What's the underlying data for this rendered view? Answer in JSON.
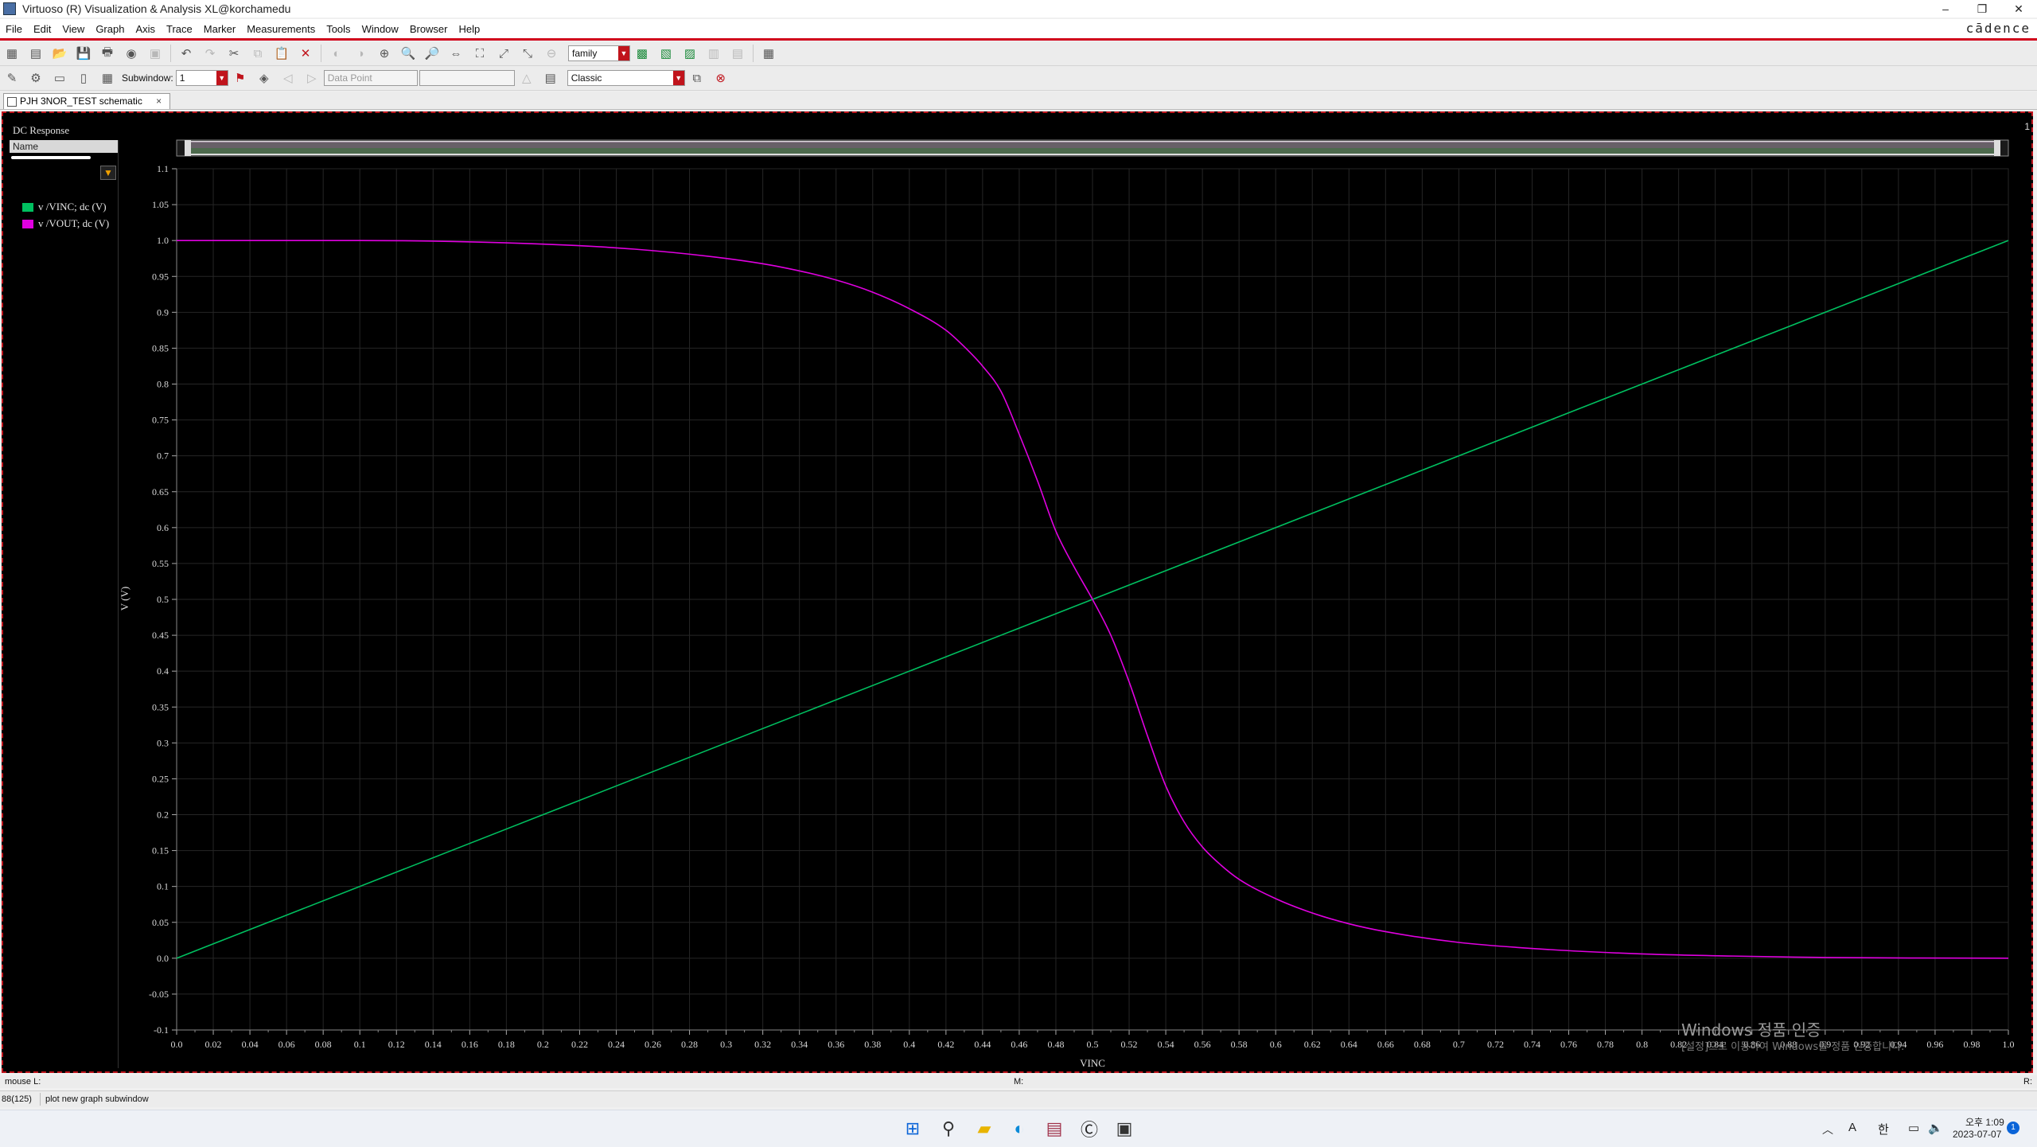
{
  "window": {
    "title": "Virtuoso (R) Visualization & Analysis XL@korchamedu",
    "controls": [
      "–",
      "❐",
      "✕"
    ]
  },
  "menu": [
    "File",
    "Edit",
    "View",
    "Graph",
    "Axis",
    "Trace",
    "Marker",
    "Measurements",
    "Tools",
    "Window",
    "Browser",
    "Help"
  ],
  "brand": "cādence",
  "toolbar": {
    "family_combo": "family",
    "subwindow_label": "Subwindow:",
    "subwindow_value": "1",
    "data_point_combo": "Data Point",
    "style_combo": "Classic"
  },
  "tab": {
    "label": "PJH 3NOR_TEST schematic",
    "close": "×"
  },
  "plot": {
    "title": "DC Response",
    "subwindow_index": "1",
    "legend_header": "Name",
    "legend": [
      {
        "label": "v /VINC; dc (V)",
        "color": "#00c060"
      },
      {
        "label": "v /VOUT; dc (V)",
        "color": "#e000e0"
      }
    ]
  },
  "chart_data": {
    "type": "line",
    "xlabel": "VINC",
    "ylabel": "V (V)",
    "xlim": [
      0.0,
      1.0
    ],
    "ylim": [
      -0.1,
      1.1
    ],
    "grid": true,
    "x_ticks": [
      "0.0",
      "0.02",
      "0.04",
      "0.06",
      "0.08",
      "0.1",
      "0.12",
      "0.14",
      "0.16",
      "0.18",
      "0.2",
      "0.22",
      "0.24",
      "0.26",
      "0.28",
      "0.3",
      "0.32",
      "0.34",
      "0.36",
      "0.38",
      "0.4",
      "0.42",
      "0.44",
      "0.46",
      "0.48",
      "0.5",
      "0.52",
      "0.54",
      "0.56",
      "0.58",
      "0.6",
      "0.62",
      "0.64",
      "0.66",
      "0.68",
      "0.7",
      "0.72",
      "0.74",
      "0.76",
      "0.78",
      "0.8",
      "0.82",
      "0.84",
      "0.86",
      "0.88",
      "0.9",
      "0.92",
      "0.94",
      "0.96",
      "0.98",
      "1.0"
    ],
    "y_ticks": [
      "1.1",
      "1.05",
      "1.0",
      "0.95",
      "0.9",
      "0.85",
      "0.8",
      "0.75",
      "0.7",
      "0.65",
      "0.6",
      "0.55",
      "0.5",
      "0.45",
      "0.4",
      "0.35",
      "0.3",
      "0.25",
      "0.2",
      "0.15",
      "0.1",
      "0.05",
      "0.0",
      "-0.05",
      "-0.1"
    ],
    "series": [
      {
        "name": "v /VINC; dc (V)",
        "color": "#00c060",
        "x": [
          0.0,
          1.0
        ],
        "y": [
          0.0,
          1.0
        ]
      },
      {
        "name": "v /VOUT; dc (V)",
        "color": "#e000e0",
        "x": [
          0.0,
          0.1,
          0.2,
          0.25,
          0.3,
          0.33,
          0.36,
          0.38,
          0.4,
          0.42,
          0.43,
          0.44,
          0.45,
          0.46,
          0.47,
          0.48,
          0.49,
          0.5,
          0.51,
          0.52,
          0.53,
          0.54,
          0.55,
          0.56,
          0.57,
          0.58,
          0.6,
          0.62,
          0.64,
          0.66,
          0.7,
          0.75,
          0.8,
          0.85,
          0.9,
          1.0
        ],
        "y": [
          1.0,
          1.0,
          0.995,
          0.988,
          0.975,
          0.963,
          0.945,
          0.928,
          0.905,
          0.875,
          0.852,
          0.825,
          0.79,
          0.73,
          0.665,
          0.595,
          0.545,
          0.5,
          0.45,
          0.385,
          0.31,
          0.24,
          0.19,
          0.155,
          0.13,
          0.11,
          0.083,
          0.063,
          0.048,
          0.037,
          0.022,
          0.012,
          0.006,
          0.003,
          0.001,
          0.0
        ]
      }
    ]
  },
  "status": {
    "mouse": "mouse L:",
    "middle": "M:",
    "right": "R:",
    "count": "88(125)",
    "message": "plot new graph subwindow"
  },
  "watermark": {
    "line1": "Windows 정품 인증",
    "line2": "[설정]으로 이동하여 Windows를 정품 인증합니다."
  },
  "taskbar": {
    "time": "오후 1:09",
    "date": "2023-07-07",
    "ime_a": "A",
    "ime_han": "한",
    "notification_count": "1"
  }
}
